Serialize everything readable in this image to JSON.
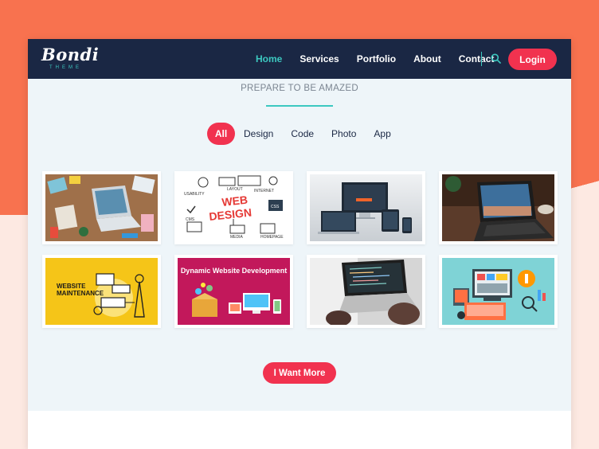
{
  "logo": {
    "main": "Bondi",
    "sub": "THEME"
  },
  "nav": {
    "items": [
      {
        "label": "Home",
        "active": true
      },
      {
        "label": "Services",
        "active": false
      },
      {
        "label": "Portfolio",
        "active": false
      },
      {
        "label": "About",
        "active": false
      },
      {
        "label": "Contact",
        "active": false
      }
    ],
    "search_icon": "search-icon",
    "login_label": "Login"
  },
  "section": {
    "subtitle": "PREPARE TO BE AMAZED"
  },
  "filters": [
    "All",
    "Design",
    "Code",
    "Photo",
    "App"
  ],
  "portfolio": {
    "web_design_line1": "WEB",
    "web_design_line2": "DESIGN",
    "wd_words": [
      "USABILITY",
      "LAYOUT",
      "INTERNET",
      "CSS",
      "CMS",
      "MEDIA",
      "HOMEPAGE"
    ],
    "maintenance_line1": "WEBSITE",
    "maintenance_line2": "MAINTENANCE",
    "dynamic_title": "Dynamic Website Development"
  },
  "more_label": "I Want More",
  "colors": {
    "navy": "#1a2744",
    "accent": "#f1324f",
    "teal": "#3cc8c0",
    "coral": "#f8724f"
  }
}
